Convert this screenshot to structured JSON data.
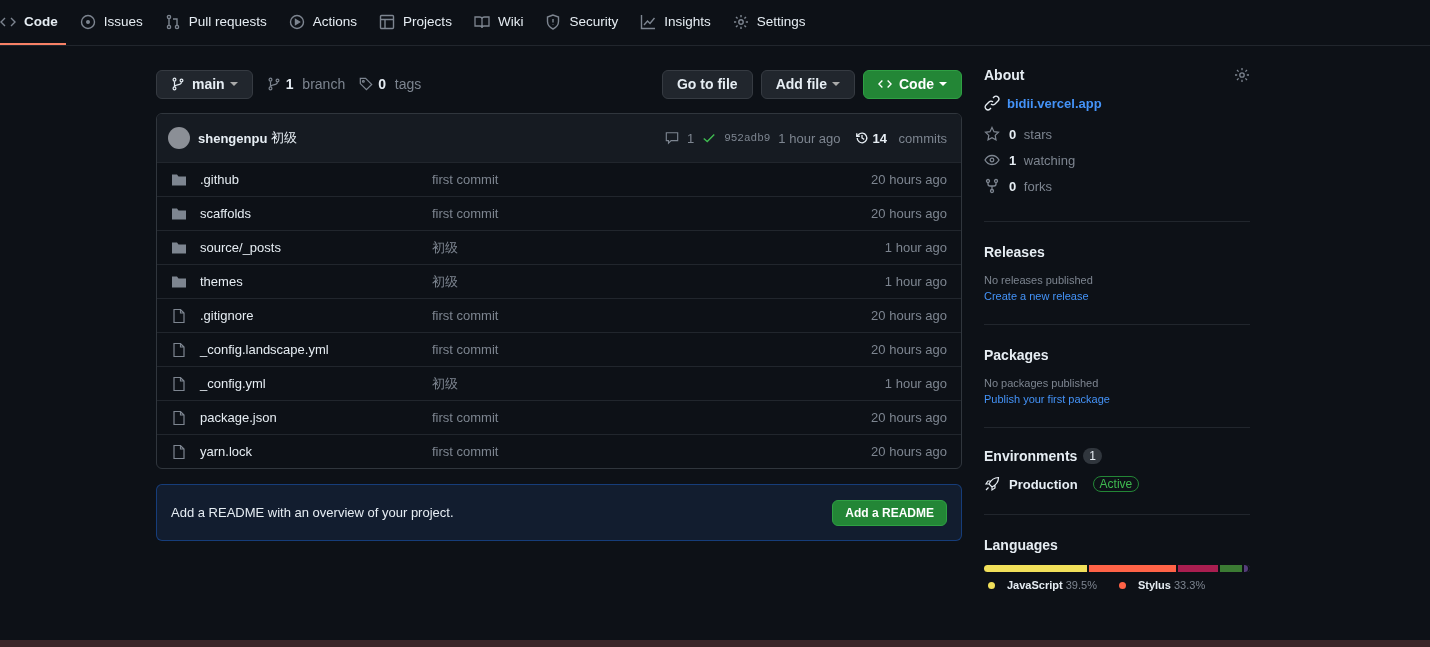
{
  "tabs": [
    {
      "label": "Code",
      "selected": true
    },
    {
      "label": "Issues",
      "selected": false
    },
    {
      "label": "Pull requests",
      "selected": false
    },
    {
      "label": "Actions",
      "selected": false
    },
    {
      "label": "Projects",
      "selected": false
    },
    {
      "label": "Wiki",
      "selected": false
    },
    {
      "label": "Security",
      "selected": false
    },
    {
      "label": "Insights",
      "selected": false
    },
    {
      "label": "Settings",
      "selected": false
    }
  ],
  "toolbar": {
    "branch_button": "main",
    "branch_count": "1",
    "branch_label": "branch",
    "tag_count": "0",
    "tag_label": "tags",
    "go_to_file": "Go to file",
    "add_file": "Add file",
    "code_button": "Code"
  },
  "commit": {
    "author": "shengenpu",
    "message": "初级",
    "comments": "1",
    "hash": "952adb9",
    "time": "1 hour ago",
    "commit_count": "14",
    "commit_label": "commits"
  },
  "files": [
    {
      "kind": "dir",
      "name": ".github",
      "message": "first commit",
      "time": "20 hours ago"
    },
    {
      "kind": "dir",
      "name": "scaffolds",
      "message": "first commit",
      "time": "20 hours ago"
    },
    {
      "kind": "dir",
      "name": "source/_posts",
      "message": "初级",
      "time": "1 hour ago"
    },
    {
      "kind": "dir",
      "name": "themes",
      "message": "初级",
      "time": "1 hour ago"
    },
    {
      "kind": "file",
      "name": ".gitignore",
      "message": "first commit",
      "time": "20 hours ago"
    },
    {
      "kind": "file",
      "name": "_config.landscape.yml",
      "message": "first commit",
      "time": "20 hours ago"
    },
    {
      "kind": "file",
      "name": "_config.yml",
      "message": "初级",
      "time": "1 hour ago"
    },
    {
      "kind": "file",
      "name": "package.json",
      "message": "first commit",
      "time": "20 hours ago"
    },
    {
      "kind": "file",
      "name": "yarn.lock",
      "message": "first commit",
      "time": "20 hours ago"
    }
  ],
  "readme": {
    "text": "Add a README with an overview of your project.",
    "button": "Add a README"
  },
  "about": {
    "title": "About",
    "link": "bidii.vercel.app",
    "stats": [
      {
        "count": "0",
        "label": "stars"
      },
      {
        "count": "1",
        "label": "watching"
      },
      {
        "count": "0",
        "label": "forks"
      }
    ]
  },
  "releases": {
    "title": "Releases",
    "note": "No releases published",
    "link": "Create a new release"
  },
  "packages": {
    "title": "Packages",
    "note": "No packages published",
    "link": "Publish your first package"
  },
  "environments": {
    "title": "Environments",
    "count": "1",
    "items": [
      {
        "name": "Production",
        "status": "Active"
      }
    ]
  },
  "languages": {
    "title": "Languages",
    "bar": [
      {
        "color": "#f1e05a",
        "level": 0.395
      },
      {
        "color": "#ff6347",
        "level": 0.333
      },
      {
        "color": "#a91e50",
        "level": 0.16
      },
      {
        "color": "#3b7b33",
        "level": 0.09
      },
      {
        "color": "#563d7c",
        "level": 0.022
      }
    ],
    "legend": [
      {
        "name": "JavaScript",
        "percent": "39.5%",
        "color": "#f1e05a"
      },
      {
        "name": "Stylus",
        "percent": "33.3%",
        "color": "#ff6347"
      }
    ]
  }
}
